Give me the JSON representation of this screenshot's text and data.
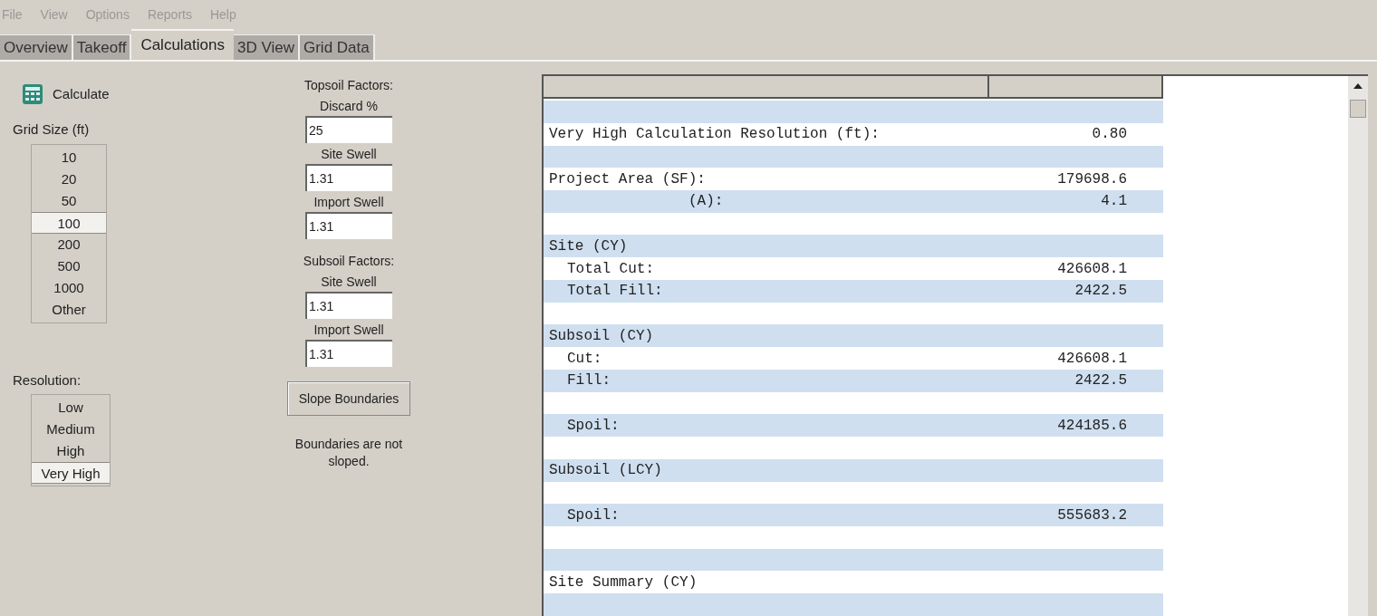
{
  "menu": [
    "File",
    "View",
    "Options",
    "Reports",
    "Help"
  ],
  "tabs": [
    {
      "label": "Overview",
      "selected": false
    },
    {
      "label": "Takeoff",
      "selected": false
    },
    {
      "label": "Calculations",
      "selected": true
    },
    {
      "label": "3D View",
      "selected": false
    },
    {
      "label": "Grid Data",
      "selected": false
    }
  ],
  "calculate_button": "Calculate",
  "grid_size": {
    "label": "Grid Size (ft)",
    "items": [
      {
        "label": "10",
        "selected": false
      },
      {
        "label": "20",
        "selected": false
      },
      {
        "label": "50",
        "selected": false
      },
      {
        "label": "100",
        "selected": true
      },
      {
        "label": "200",
        "selected": false
      },
      {
        "label": "500",
        "selected": false
      },
      {
        "label": "1000",
        "selected": false
      },
      {
        "label": "Other",
        "selected": false
      }
    ]
  },
  "resolution": {
    "label": "Resolution:",
    "items": [
      {
        "label": "Low",
        "selected": false
      },
      {
        "label": "Medium",
        "selected": false
      },
      {
        "label": "High",
        "selected": false
      },
      {
        "label": "Very High",
        "selected": true
      }
    ]
  },
  "factor_groups": [
    {
      "title": "Topsoil Factors:",
      "fields": [
        {
          "label": "Discard %",
          "value": "25"
        },
        {
          "label": "Site Swell",
          "value": "1.31"
        },
        {
          "label": "Import Swell",
          "value": "1.31"
        }
      ]
    },
    {
      "title": "Subsoil Factors:",
      "fields": [
        {
          "label": "Site Swell",
          "value": "1.31"
        },
        {
          "label": "Import Swell",
          "value": "1.31"
        }
      ]
    }
  ],
  "slope_button": "Slope Boundaries",
  "slope_note": "Boundaries are not sloped.",
  "report_rows": [
    {
      "kind": "blank"
    },
    {
      "kind": "heading",
      "label": "Very High Calculation Resolution (ft):",
      "value": "0.80"
    },
    {
      "kind": "blank"
    },
    {
      "kind": "heading",
      "label": "Project Area (SF):",
      "value": "179698.6"
    },
    {
      "kind": "unit",
      "label": "(A):",
      "value": "4.1"
    },
    {
      "kind": "blank"
    },
    {
      "kind": "heading",
      "label": "Site (CY)"
    },
    {
      "kind": "item",
      "label": "Total Cut:",
      "value": "426608.1"
    },
    {
      "kind": "item",
      "label": "Total Fill:",
      "value": "2422.5"
    },
    {
      "kind": "blank"
    },
    {
      "kind": "heading",
      "label": "Subsoil (CY)"
    },
    {
      "kind": "item",
      "label": "Cut:",
      "value": "426608.1"
    },
    {
      "kind": "item",
      "label": "Fill:",
      "value": "2422.5"
    },
    {
      "kind": "blank"
    },
    {
      "kind": "item",
      "label": "Spoil:",
      "value": "424185.6"
    },
    {
      "kind": "blank"
    },
    {
      "kind": "heading",
      "label": "Subsoil (LCY)"
    },
    {
      "kind": "blank"
    },
    {
      "kind": "item",
      "label": "Spoil:",
      "value": "555683.2"
    },
    {
      "kind": "blank"
    },
    {
      "kind": "blank"
    },
    {
      "kind": "heading",
      "label": "Site Summary (CY)"
    },
    {
      "kind": "blank"
    }
  ]
}
